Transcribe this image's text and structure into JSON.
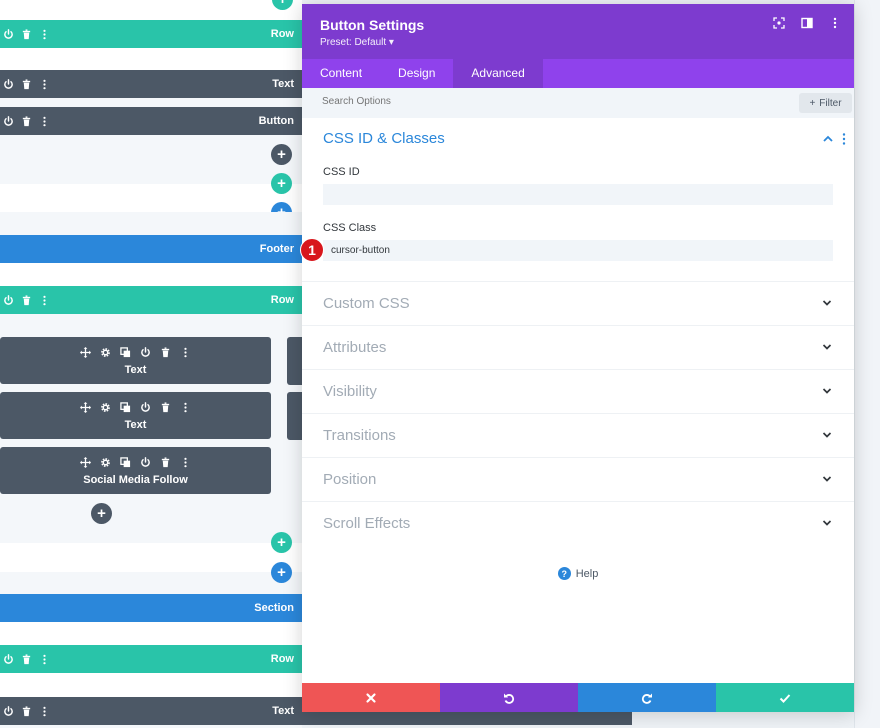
{
  "builder": {
    "rows": [
      {
        "label": "Row"
      },
      {
        "label": "Text"
      },
      {
        "label": "Button"
      },
      {
        "label": "Footer"
      },
      {
        "label": "Row"
      },
      {
        "label": "Section"
      },
      {
        "label": "Row"
      },
      {
        "label": "Text"
      }
    ],
    "modules": [
      {
        "label": "Text"
      },
      {
        "label": "Text"
      },
      {
        "label": "Social Media Follow"
      }
    ],
    "add_symbol": "+"
  },
  "modal": {
    "title": "Button Settings",
    "preset": "Preset: Default ▾",
    "tabs": [
      {
        "label": "Content"
      },
      {
        "label": "Design"
      },
      {
        "label": "Advanced"
      }
    ],
    "search": {
      "placeholder": "Search Options"
    },
    "filter_label": "Filter",
    "open_section": {
      "title": "CSS ID & Classes",
      "fields": [
        {
          "label": "CSS ID",
          "value": ""
        },
        {
          "label": "CSS Class",
          "value": "cursor-button"
        }
      ]
    },
    "marker": "1",
    "sections": [
      {
        "title": "Custom CSS"
      },
      {
        "title": "Attributes"
      },
      {
        "title": "Visibility"
      },
      {
        "title": "Transitions"
      },
      {
        "title": "Position"
      },
      {
        "title": "Scroll Effects"
      }
    ],
    "help_label": "Help",
    "colors": {
      "purple_header": "#7d3bcf",
      "purple_tabs": "#8f42ec",
      "teal": "#29c4a9",
      "blue": "#2b87da",
      "dark": "#4c5866",
      "red": "#ef5555"
    }
  }
}
